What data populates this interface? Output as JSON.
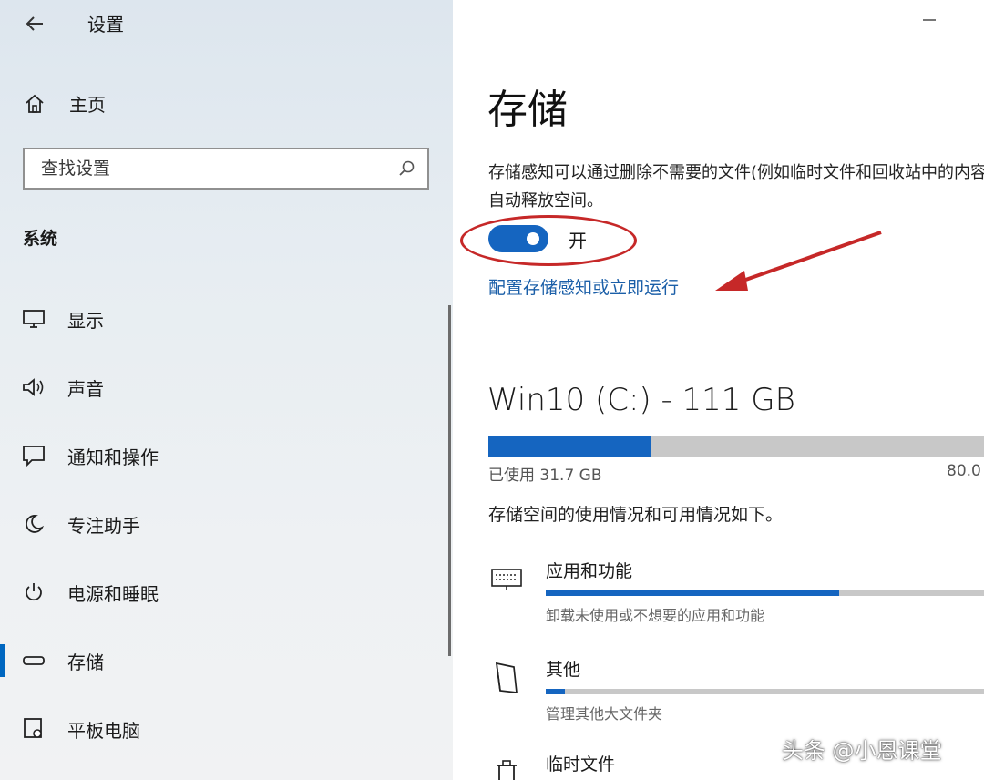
{
  "app": {
    "title": "设置"
  },
  "sidebar": {
    "home_label": "主页",
    "search_placeholder": "查找设置",
    "section_label": "系统",
    "items": [
      {
        "label": "显示",
        "icon": "monitor-icon"
      },
      {
        "label": "声音",
        "icon": "speaker-icon"
      },
      {
        "label": "通知和操作",
        "icon": "notification-icon"
      },
      {
        "label": "专注助手",
        "icon": "moon-icon"
      },
      {
        "label": "电源和睡眠",
        "icon": "power-icon"
      },
      {
        "label": "存储",
        "icon": "storage-drive-icon",
        "active": true
      },
      {
        "label": "平板电脑",
        "icon": "tablet-icon"
      }
    ]
  },
  "main": {
    "title": "存储",
    "description": "存储感知可以通过删除不需要的文件(例如临时文件和回收站中的内容)自动释放空间。",
    "storage_sense": {
      "state": "开",
      "on": true
    },
    "configure_link": "配置存储感知或立即运行",
    "drive": {
      "title": "Win10 (C:) - 111 GB",
      "used_label": "已使用 31.7 GB",
      "free_label": "80.0",
      "used_fraction": 0.318
    },
    "summary": "存储空间的使用情况和可用情况如下。",
    "categories": [
      {
        "name": "应用和功能",
        "desc": "卸载未使用或不想要的应用和功能",
        "fraction": 0.62,
        "icon": "apps-keyboard-icon"
      },
      {
        "name": "其他",
        "desc": "管理其他大文件夹",
        "fraction": 0.04,
        "icon": "folder-icon"
      },
      {
        "name": "临时文件",
        "icon": "trash-icon"
      }
    ]
  },
  "colors": {
    "accent": "#1565c0",
    "annotation": "#c62828"
  },
  "watermark": "头条 @小恩课堂"
}
